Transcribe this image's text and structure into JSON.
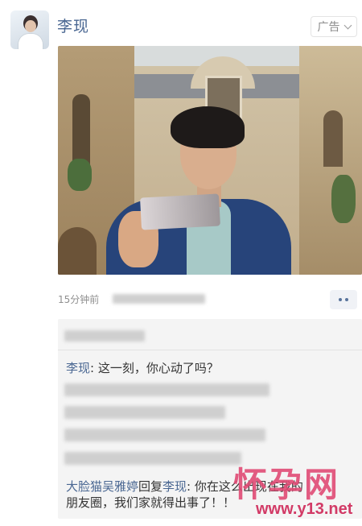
{
  "post": {
    "author": "李现",
    "ad_label": "广告",
    "time": "15分钟前"
  },
  "comments": {
    "first": {
      "user": "李现",
      "text": ": 这一刻，你心动了吗？"
    },
    "reply": {
      "user": "大脸猫吴雅婷",
      "verb": "回复",
      "target": "李现",
      "text_line1": ": 你在这么出现在我的",
      "text_line2": "朋友圈，我们家就得出事了！！"
    }
  },
  "watermark": {
    "text": "怀孕网",
    "url": "www.y13.net"
  }
}
